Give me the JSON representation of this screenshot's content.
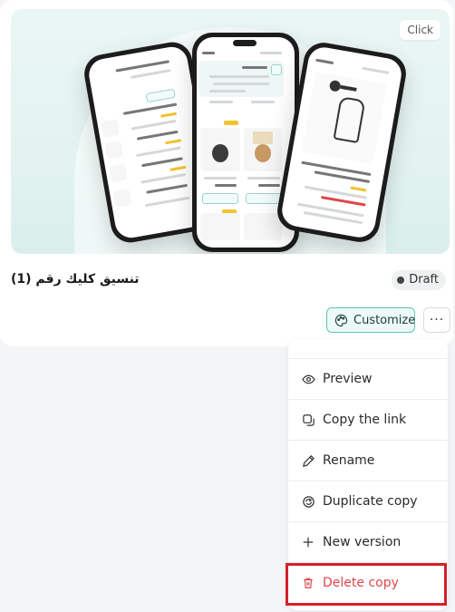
{
  "template_card": {
    "title": "تنسيق كليك رقم (1)",
    "status": "Draft",
    "preview_badge": "Click",
    "customize_label": "Customize",
    "more_label": "···"
  },
  "menu": {
    "items": [
      {
        "label": "Preview",
        "icon": "eye-icon"
      },
      {
        "label": "Copy the link",
        "icon": "copy-link-icon"
      },
      {
        "label": "Rename",
        "icon": "pencil-icon"
      },
      {
        "label": "Duplicate copy",
        "icon": "duplicate-icon"
      },
      {
        "label": "New version",
        "icon": "plus-icon"
      },
      {
        "label": "Delete copy",
        "icon": "trash-icon"
      }
    ]
  },
  "colors": {
    "accent": "#5ec3b9",
    "delete": "#e0474c",
    "highlight_box": "#d4202a"
  }
}
